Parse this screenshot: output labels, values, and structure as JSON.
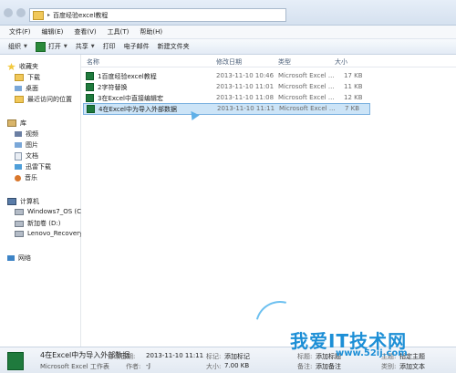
{
  "address": {
    "path": "百度经验excel教程"
  },
  "menu": [
    "文件(F)",
    "编辑(E)",
    "查看(V)",
    "工具(T)",
    "帮助(H)"
  ],
  "toolbar": {
    "organize": "组织",
    "open": "打开",
    "share": "共享",
    "print": "打印",
    "email": "电子邮件",
    "new_folder": "新建文件夹"
  },
  "sidebar": {
    "favorites": "收藏夹",
    "downloads": "下载",
    "desktop": "桌面",
    "recent": "最近访问的位置",
    "libraries": "库",
    "videos": "视频",
    "pictures": "图片",
    "documents": "文档",
    "thunder": "迅雷下载",
    "music": "音乐",
    "computer": "计算机",
    "drive_c": "Windows7_OS (C:)",
    "drive_d": "新加卷 (D:)",
    "drive_e": "Lenovo_Recovery",
    "network": "网络"
  },
  "columns": {
    "name": "名称",
    "date": "修改日期",
    "type": "类型",
    "size": "大小"
  },
  "files": [
    {
      "name": "1百度经验excel教程",
      "date": "2013-11-10 10:46",
      "type": "Microsoft Excel ...",
      "size": "17 KB"
    },
    {
      "name": "2字符替换",
      "date": "2013-11-10 11:01",
      "type": "Microsoft Excel ...",
      "size": "11 KB"
    },
    {
      "name": "3在Excel中直接编辑宏",
      "date": "2013-11-10 11:08",
      "type": "Microsoft Excel ...",
      "size": "12 KB"
    },
    {
      "name": "4在Excel中为导入外部数据",
      "date": "2013-11-10 11:11",
      "type": "Microsoft Excel ...",
      "size": "7 KB"
    }
  ],
  "status": {
    "filename": "4在Excel中为导入外部数据",
    "filetype": "Microsoft Excel 工作表",
    "modified_label": "修改日期:",
    "modified_value": "2013-11-10 11:11",
    "author_label": "作者:",
    "author_value": "-J",
    "tags_label": "标记:",
    "tags_value": "添加标记",
    "size_label": "大小:",
    "size_value": "7.00 KB",
    "title_label": "标题:",
    "title_value": "添加标题",
    "remark_label": "备注:",
    "remark_value": "添加备注",
    "subject_label": "主题:",
    "subject_value": "指定主题",
    "category_label": "类别:",
    "category_value": "添加文本"
  },
  "watermark": {
    "text": "我爱IT技术网",
    "url": "www.52ij.com"
  }
}
